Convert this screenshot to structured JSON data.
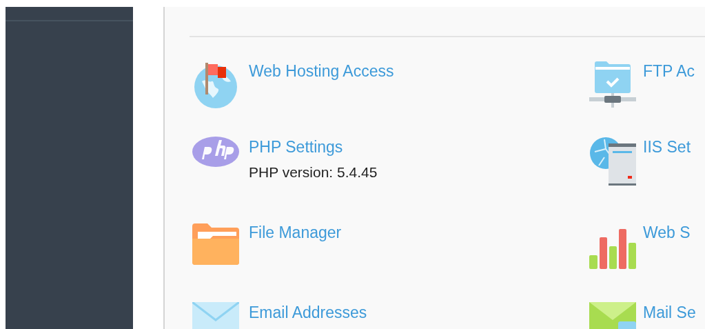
{
  "content": {
    "columns": [
      [
        {
          "title": "Web Hosting Access"
        },
        {
          "title": "PHP Settings",
          "subtitle": "PHP version: 5.4.45"
        },
        {
          "title": "File Manager"
        },
        {
          "title": "Email Addresses"
        }
      ],
      [
        {
          "title": "FTP Ac"
        },
        {
          "title": "IIS Set"
        },
        {
          "title": "Web S"
        },
        {
          "title": "Mail Se"
        }
      ]
    ]
  }
}
